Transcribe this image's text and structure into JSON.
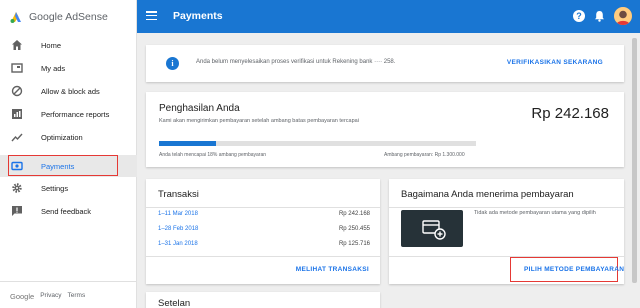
{
  "app": {
    "name": "Google AdSense"
  },
  "header": {
    "title": "Payments",
    "help_glyph": "?"
  },
  "sidebar": {
    "items": [
      {
        "label": "Home",
        "icon": "home-icon"
      },
      {
        "label": "My ads",
        "icon": "ads-icon"
      },
      {
        "label": "Allow & block ads",
        "icon": "block-icon"
      },
      {
        "label": "Performance reports",
        "icon": "reports-icon"
      },
      {
        "label": "Optimization",
        "icon": "trending-icon"
      },
      {
        "label": "Payments",
        "icon": "payments-icon",
        "active": true
      },
      {
        "label": "Settings",
        "icon": "gear-icon"
      },
      {
        "label": "Send feedback",
        "icon": "feedback-icon"
      }
    ],
    "footer": {
      "google": "Google",
      "privacy": "Privacy",
      "terms": "Terms"
    }
  },
  "banner": {
    "info_glyph": "i",
    "text": "Anda belum menyelesaikan proses verifikasi untuk Rekening bank ···· 258.",
    "action": "VERIFIKASIKAN SEKARANG"
  },
  "earnings": {
    "title": "Penghasilan Anda",
    "subtitle": "Kami akan mengirimkan pembayaran setelah ambang batas pembayaran tercapai",
    "amount": "Rp 242.168",
    "progress_fraction": 0.18,
    "progress_text": "Anda telah mencapai 18% ambang pembayaran",
    "threshold_text": "Ambang pembayaran: Rp 1.300.000"
  },
  "transactions": {
    "title": "Transaksi",
    "rows": [
      {
        "date": "1–11 Mar 2018",
        "amount": "Rp 242.168"
      },
      {
        "date": "1–28 Feb 2018",
        "amount": "Rp 250.455"
      },
      {
        "date": "1–31 Jan 2018",
        "amount": "Rp 125.716"
      }
    ],
    "action": "MELIHAT TRANSAKSI"
  },
  "payment_method": {
    "title": "Bagaimana Anda menerima pembayaran",
    "text": "Tidak ada metode pembayaran utama yang dipilih",
    "action": "PILIH METODE PEMBAYARAN"
  },
  "settings_card": {
    "title": "Setelan"
  },
  "colors": {
    "accent": "#1976d2",
    "highlight": "#e53935",
    "link": "#1a73e8"
  }
}
